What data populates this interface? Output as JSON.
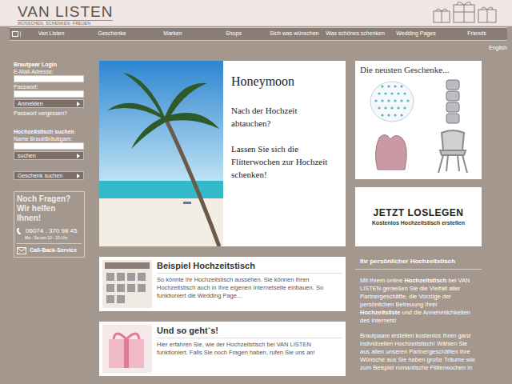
{
  "header": {
    "logo": "VAN LISTEN",
    "tagline": "WÜNSCHEN. SCHENKEN. FREUEN."
  },
  "nav": {
    "items": [
      "Van Listen",
      "Geschenke",
      "Marken",
      "Shops",
      "Sich was wünschen",
      "Was schönes schenken",
      "Wedding Pages",
      "Friends"
    ]
  },
  "language": "English",
  "login": {
    "title": "Brautpaar Login",
    "email_label": "E-Mail-Adresse:",
    "password_label": "Passwort:",
    "button": "Anmelden",
    "forgot": "Passwort vergessen?"
  },
  "table_search": {
    "title": "Hochzeitstisch suchen",
    "label": "Name Braut/Bräutigam:",
    "button": "suchen"
  },
  "gift_search": {
    "button": "Geschenk suchen"
  },
  "help": {
    "title": "Noch Fragen?",
    "subtitle": "Wir helfen Ihnen!",
    "phone": "06074 . 370 98 45",
    "hours": "Mo - Sa von 10 - 20 Uhr",
    "callback": "Call-Back-Service"
  },
  "hero": {
    "title": "Honeymoon",
    "lines": [
      "Nach der Hochzeit abtauchen?",
      "Lassen Sie sich die Flitterwochen zur Hochzeit schenken!"
    ]
  },
  "features": [
    {
      "title": "Beispiel Hochzeitstisch",
      "text": "So könnte Ihr Hochzeitstisch aussehen. Sie können Ihren Hochzeitstisch auch in Ihre eigenen Internetseite einbauen. So funktioniert die Wedding Page..."
    },
    {
      "title": "Und so geht`s!",
      "text": "Hier erfahren Sie, wie der Hochzeitstisch bei VAN LISTEN funktioniert. Falls Sie noch Fragen haben, rufen Sie uns an!"
    }
  ],
  "newest": {
    "title": "Die neusten Geschenke..."
  },
  "cta": {
    "title": "JETZT LOSLEGEN",
    "subtitle": "Kostenlos Hochzeitstisch erstellen"
  },
  "info": {
    "title": "Ihr persönlicher Hochzeitstisch",
    "paragraphs": [
      [
        {
          "text": "Mit Ihrem online ",
          "bold": false
        },
        {
          "text": "Hochzeitstisch",
          "bold": true
        },
        {
          "text": " bei VAN LISTEN genießen Sie die Vielfalt aller Partnergeschäfte, die Vorzüge der persönlichen Betreuung Ihrer ",
          "bold": false
        },
        {
          "text": "Hochzeitsliste",
          "bold": true
        },
        {
          "text": " und die Annehmlichkeiten des Internets!",
          "bold": false
        }
      ],
      [
        {
          "text": "Brautpaare erstellen kostenlos Ihren ganz individuellen Hochzeitstisch! Wählen Sie aus allen unseren Partnergeschäften Ihre Wünsche aus Sie haben große Träume wie zum Beispiel romantische Flitterwochen in",
          "bold": false
        }
      ]
    ]
  }
}
